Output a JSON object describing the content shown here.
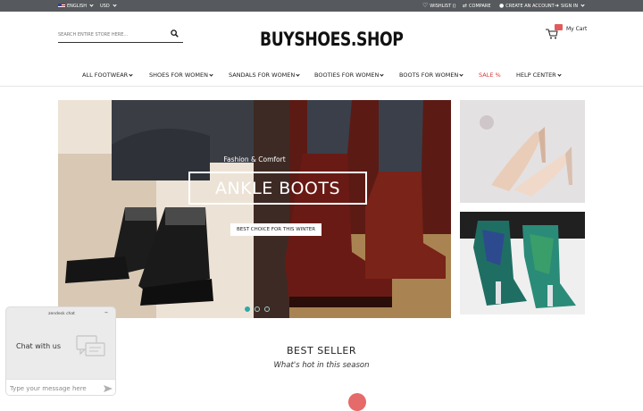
{
  "topbar": {
    "language": "ENGLISH",
    "currency": "USD",
    "wishlist": "WISHLIST ()",
    "compare": "COMPARE",
    "create_account": "CREATE AN ACCOUNT",
    "sign_in": "SIGN IN"
  },
  "search": {
    "placeholder": "SEARCH ENTIRE STORE HERE..."
  },
  "logo": {
    "text": "BUYSHOES.SHOP"
  },
  "cart": {
    "label": "My Cart"
  },
  "nav": {
    "items": [
      {
        "label": "ALL FOOTWEAR"
      },
      {
        "label": "SHOES FOR WOMEN"
      },
      {
        "label": "SANDALS FOR WOMEN"
      },
      {
        "label": "BOOTIES FOR WOMEN"
      },
      {
        "label": "BOOTS FOR WOMEN"
      },
      {
        "label": "SALE %"
      },
      {
        "label": "HELP CENTER"
      }
    ],
    "sale_color": "#d63a3a"
  },
  "hero": {
    "subtitle": "Fashion & Comfort",
    "title": "ANKLE BOOTS",
    "cta": "BEST CHOICE FOR THIS WINTER",
    "active_slide": 1,
    "slide_count": 3
  },
  "best_seller": {
    "title": "BEST SELLER",
    "subtitle": "What's hot in this season"
  },
  "chat": {
    "header": "zendesk chat",
    "label": "Chat with us",
    "placeholder": "Type your message here"
  },
  "colors": {
    "topbar": "#56595d",
    "accent_teal": "#2fa8a8",
    "sale_red": "#d63a3a"
  }
}
